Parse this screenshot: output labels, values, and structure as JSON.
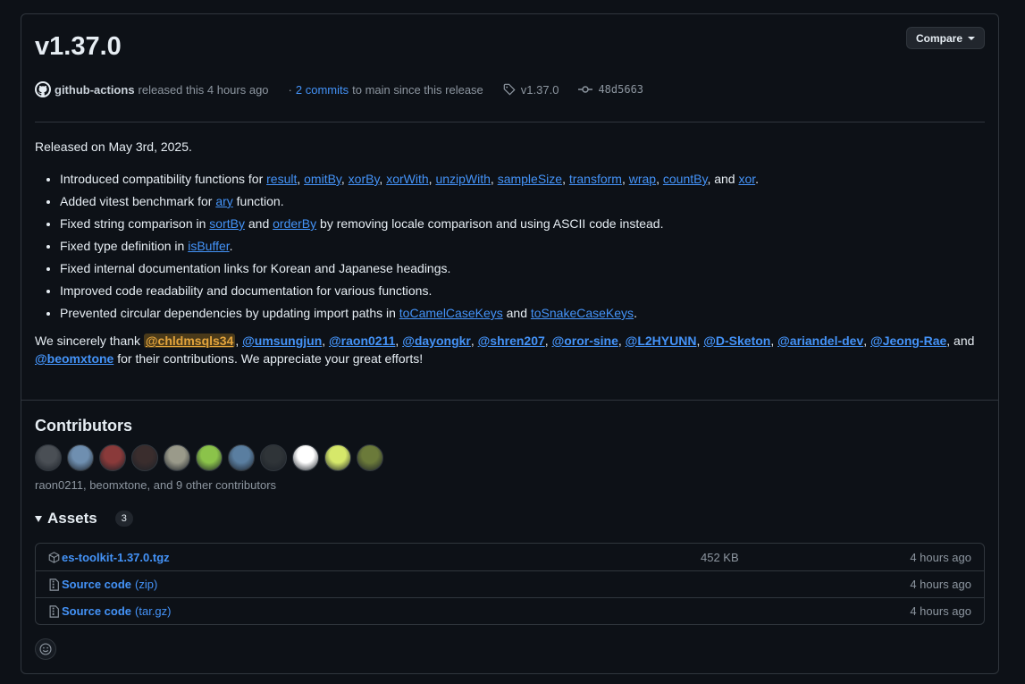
{
  "release": {
    "title": "v1.37.0",
    "compare_label": "Compare",
    "actor": "github-actions",
    "released_text": "released this 4 hours ago",
    "commits_prefix": "·",
    "commits_link": "2 commits",
    "commits_suffix": "to main since this release",
    "tag": "v1.37.0",
    "commit_sha": "48d5663"
  },
  "notes": {
    "released_on": "Released on May 3rd, 2025.",
    "items": [
      {
        "parts": [
          {
            "t": "Introduced compatibility functions for "
          },
          {
            "t": "result",
            "link": true
          },
          {
            "t": ", "
          },
          {
            "t": "omitBy",
            "link": true
          },
          {
            "t": ", "
          },
          {
            "t": "xorBy",
            "link": true
          },
          {
            "t": ", "
          },
          {
            "t": "xorWith",
            "link": true
          },
          {
            "t": ", "
          },
          {
            "t": "unzipWith",
            "link": true
          },
          {
            "t": ", "
          },
          {
            "t": "sampleSize",
            "link": true
          },
          {
            "t": ", "
          },
          {
            "t": "transform",
            "link": true
          },
          {
            "t": ", "
          },
          {
            "t": "wrap",
            "link": true
          },
          {
            "t": ", "
          },
          {
            "t": "countBy",
            "link": true
          },
          {
            "t": ", and "
          },
          {
            "t": "xor",
            "link": true
          },
          {
            "t": "."
          }
        ]
      },
      {
        "parts": [
          {
            "t": "Added vitest benchmark for "
          },
          {
            "t": "ary",
            "link": true
          },
          {
            "t": " function."
          }
        ]
      },
      {
        "parts": [
          {
            "t": "Fixed string comparison in "
          },
          {
            "t": "sortBy",
            "link": true
          },
          {
            "t": " and "
          },
          {
            "t": "orderBy",
            "link": true
          },
          {
            "t": " by removing locale comparison and using ASCII code instead."
          }
        ]
      },
      {
        "parts": [
          {
            "t": "Fixed type definition in "
          },
          {
            "t": "isBuffer",
            "link": true
          },
          {
            "t": "."
          }
        ]
      },
      {
        "parts": [
          {
            "t": "Fixed internal documentation links for Korean and Japanese headings."
          }
        ]
      },
      {
        "parts": [
          {
            "t": "Improved code readability and documentation for various functions."
          }
        ]
      },
      {
        "parts": [
          {
            "t": "Prevented circular dependencies by updating import paths in "
          },
          {
            "t": "toCamelCaseKeys",
            "link": true
          },
          {
            "t": " and "
          },
          {
            "t": "toSnakeCaseKeys",
            "link": true
          },
          {
            "t": "."
          }
        ]
      }
    ],
    "thanks_prefix": "We sincerely thank ",
    "mentions": [
      {
        "name": "@chldmsqls34",
        "highlight": true
      },
      {
        "name": "@umsungjun"
      },
      {
        "name": "@raon0211"
      },
      {
        "name": "@dayongkr"
      },
      {
        "name": "@shren207"
      },
      {
        "name": "@oror-sine"
      },
      {
        "name": "@L2HYUNN"
      },
      {
        "name": "@D-Sketon"
      },
      {
        "name": "@ariandel-dev"
      },
      {
        "name": "@Jeong-Rae"
      },
      {
        "name": "@beomxtone"
      }
    ],
    "thanks_and": ", and",
    "thanks_suffix": " for their contributions. We appreciate your great efforts!"
  },
  "contributors": {
    "title": "Contributors",
    "avatar_colors": [
      "#4a4f55",
      "#6f8fb0",
      "#8a3a3a",
      "#3a2d2d",
      "#9a9a8a",
      "#8bc34a",
      "#5a7ea0",
      "#2f3438",
      "#ffffff",
      "#d6e86a",
      "#6b7a3a"
    ],
    "summary": "raon0211, beomxtone, and 9 other contributors"
  },
  "assets": {
    "title": "Assets",
    "count": "3",
    "rows": [
      {
        "icon": "package-icon",
        "name": "es-toolkit-1.37.0.tgz",
        "suffix": "",
        "size": "452 KB",
        "date": "4 hours ago"
      },
      {
        "icon": "file-zip-icon",
        "name": "Source code",
        "suffix": "(zip)",
        "size": "",
        "date": "4 hours ago"
      },
      {
        "icon": "file-zip-icon",
        "name": "Source code",
        "suffix": "(tar.gz)",
        "size": "",
        "date": "4 hours ago"
      }
    ]
  },
  "colors": {
    "background": "#0d1117",
    "border": "#30363d",
    "link": "#4493f8",
    "muted": "#8d96a0",
    "highlight": "#e3a43c"
  }
}
